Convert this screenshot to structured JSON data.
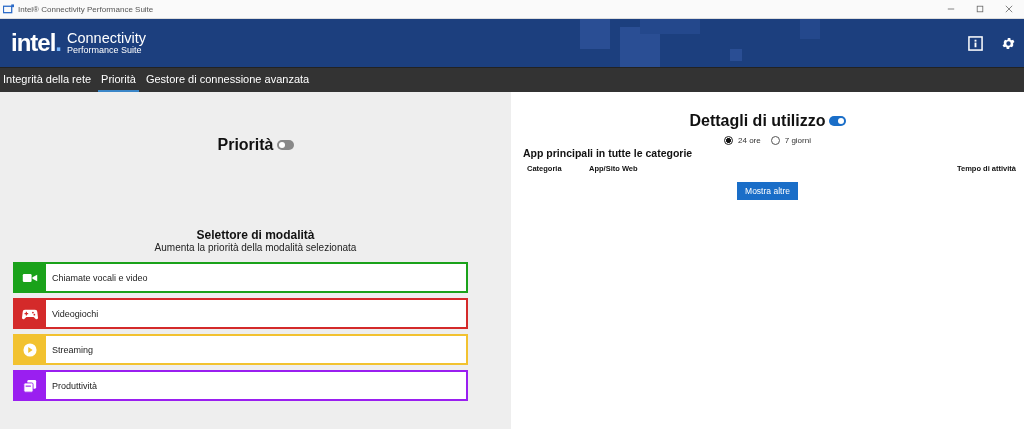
{
  "window": {
    "title": "Intel® Connectivity Performance Suite"
  },
  "header": {
    "brand": "intel",
    "brand_mark": ".",
    "product": "Connectivity",
    "subtitle": "Performance Suite"
  },
  "tabs": [
    {
      "label": "Integrità della rete",
      "selected": false
    },
    {
      "label": "Priorità",
      "selected": true
    },
    {
      "label": "Gestore di connessione avanzata",
      "selected": false
    }
  ],
  "priority": {
    "title": "Priorità",
    "on": false
  },
  "mode_selector": {
    "title": "Selettore di modalità",
    "subtitle": "Aumenta la priorità della modalità selezionata",
    "modes": [
      {
        "kind": "video",
        "label": "Chiamate vocali e video",
        "color": "#1aa21a"
      },
      {
        "kind": "game",
        "label": "Videogiochi",
        "color": "#d42a2a"
      },
      {
        "kind": "play",
        "label": "Streaming",
        "color": "#f2c230"
      },
      {
        "kind": "stack",
        "label": "Produttività",
        "color": "#9a1ff0"
      }
    ]
  },
  "usage": {
    "title": "Dettagli di utilizzo",
    "on": true,
    "ranges": [
      {
        "label": "24 ore",
        "selected": true
      },
      {
        "label": "7 giorni",
        "selected": false
      }
    ],
    "section_title": "App principali in tutte le categorie",
    "columns": [
      "Categoria",
      "App/Sito Web",
      "Tempo di attività"
    ],
    "more_button": "Mostra altre"
  }
}
